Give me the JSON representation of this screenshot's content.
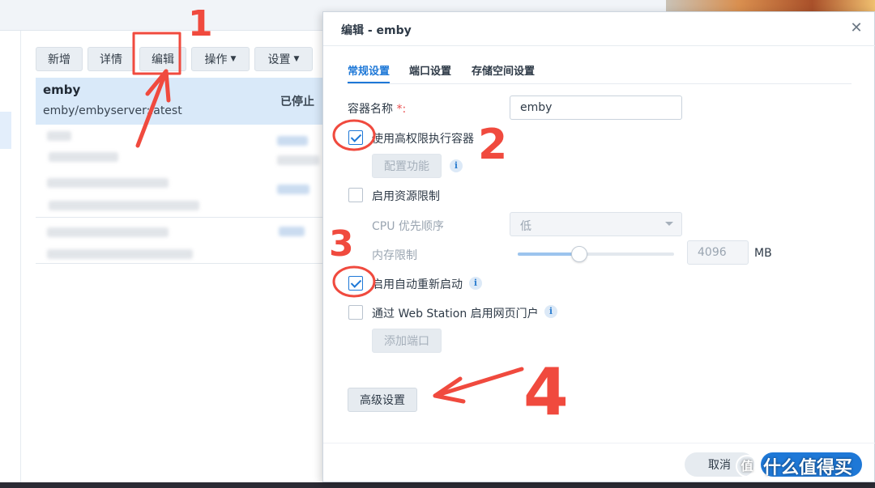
{
  "background_app": {
    "toolbar": {
      "create": "新增",
      "details": "详情",
      "edit": "编辑",
      "action": "操作",
      "settings": "设置"
    },
    "selected_row": {
      "name": "emby",
      "image": "emby/embyserver:latest",
      "status": "已停止"
    }
  },
  "dialog": {
    "title": "编辑 - emby",
    "tabs": [
      "常规设置",
      "端口设置",
      "存储空间设置"
    ],
    "container_name": {
      "label": "容器名称",
      "required_mark": "*:",
      "value": "emby"
    },
    "privileged": {
      "label": "使用高权限执行容器",
      "checked": true,
      "config_button": "配置功能"
    },
    "resource_limit": {
      "label": "启用资源限制",
      "checked": false,
      "cpu_label": "CPU 优先顺序",
      "cpu_value": "低",
      "memory_label": "内存限制",
      "memory_value": "4096",
      "memory_unit": "MB",
      "memory_fill_fraction": 0.4
    },
    "auto_restart": {
      "label": "启用自动重新启动",
      "checked": true
    },
    "web_station": {
      "label": "通过 Web Station 启用网页门户",
      "checked": false,
      "add_port_button": "添加端口"
    },
    "advanced_button": "高级设置",
    "footer": {
      "cancel": "取消"
    },
    "close_icon": "close-icon"
  },
  "watermark": {
    "icon_text": "值",
    "text": "什么值得买"
  },
  "annotations": {
    "color": "#f04a3e",
    "labels": [
      "1",
      "2",
      "3",
      "4"
    ]
  }
}
